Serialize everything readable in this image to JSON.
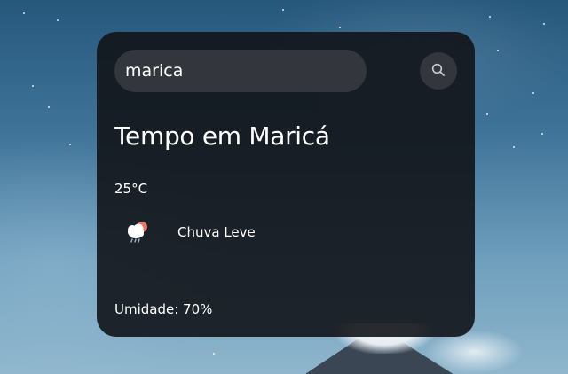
{
  "search": {
    "value": "marica",
    "button_icon": "search-icon"
  },
  "weather": {
    "title": "Tempo em Maricá",
    "temperature": "25°C",
    "condition_icon": "light-rain-cloud-icon",
    "condition": "Chuva Leve",
    "humidity": "Umidade: 70%"
  },
  "colors": {
    "card_background": "#141619",
    "input_background": "#33373d",
    "text": "#ffffff"
  }
}
